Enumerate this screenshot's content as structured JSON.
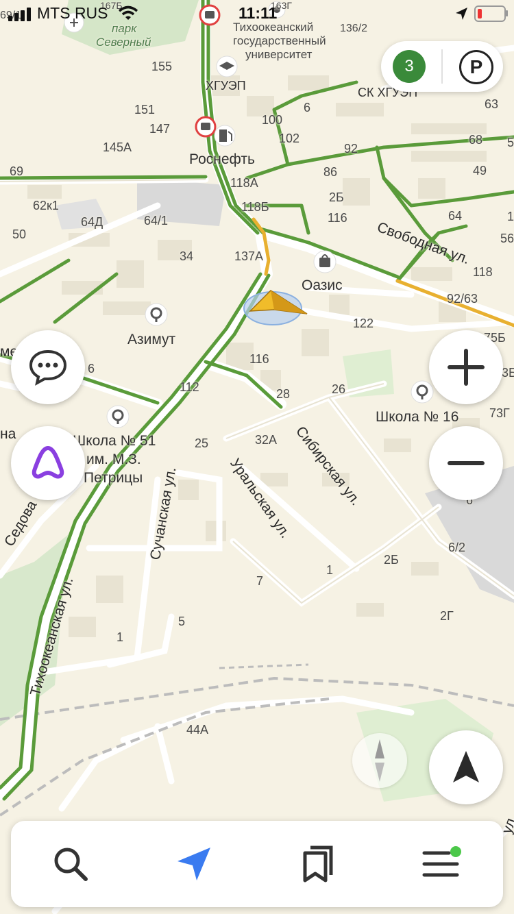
{
  "status": {
    "carrier": "MTS RUS",
    "time": "11:11"
  },
  "map": {
    "park": [
      "парк",
      "Северный"
    ],
    "pois": {
      "university": [
        "Тихоокеанский",
        "государственный",
        "университет"
      ],
      "khguep": "ХГУЭП",
      "sk": "СК ХГУЭП",
      "rosneft": "Роснефть",
      "oasis": "Оазис",
      "azimut": "Азимут",
      "school16": "Школа № 16",
      "school51": [
        "Школа № 51",
        "им. М.З.",
        "Петрицы"
      ]
    },
    "streets": {
      "svobodnaya": "Свободная ул.",
      "sibirskaya": "Сибирская ул.",
      "uralskaya": "Уральская ул.",
      "suchanskaya": "Сучанская ул.",
      "tikhookeanskaya": "Тихоокеанская ул.",
      "sedova": "Седова",
      "me": "ме",
      "na": "на",
      "ul": "ул"
    },
    "numbers": [
      "155",
      "151",
      "147",
      "145А",
      "69",
      "62к1",
      "64Д",
      "64/1",
      "50",
      "34",
      "100",
      "102",
      "92",
      "86",
      "2Б",
      "116",
      "118А",
      "118Б",
      "137А",
      "6",
      "63",
      "68",
      "49",
      "64",
      "56",
      "118",
      "92/63",
      "122",
      "75Б",
      "3Б",
      "73Г",
      "116",
      "6",
      "112",
      "28",
      "26",
      "25",
      "32А",
      "6",
      "6/2",
      "2Б",
      "1",
      "7",
      "2Г",
      "5",
      "1",
      "44А",
      "136/2",
      "69/1",
      "167Б",
      "163Г",
      "5",
      "1",
      "5"
    ]
  },
  "controls": {
    "traffic_level": "3",
    "parking_label": "P"
  },
  "bottom_nav": [
    "search",
    "navigator",
    "bookmarks",
    "menu"
  ],
  "colors": {
    "accent": "#3a7bf0",
    "traffic_green": "#5a9b3a",
    "traffic_yellow": "#e8b030",
    "alice": "#8a3fe0"
  }
}
